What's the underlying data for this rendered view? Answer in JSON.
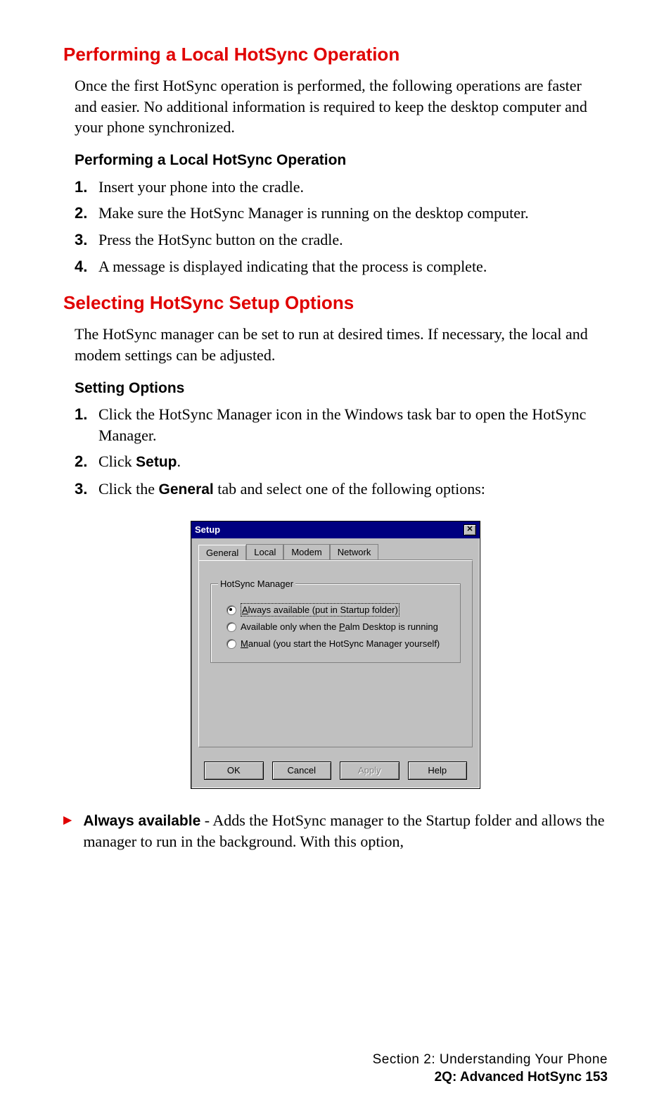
{
  "section1": {
    "heading": "Performing a Local HotSync Operation",
    "para": "Once the first HotSync operation is performed, the following operations are faster and easier. No additional information is required to keep the desktop computer and your phone synchronized.",
    "subheading": "Performing a Local HotSync Operation",
    "steps": [
      "Insert your phone into the cradle.",
      "Make sure the HotSync Manager is running on the desktop computer.",
      "Press the HotSync button on the cradle.",
      "A message is displayed indicating that the process is complete."
    ]
  },
  "section2": {
    "heading": "Selecting HotSync Setup Options",
    "para": "The HotSync manager can be set to run at desired times. If necessary, the local and modem settings can be adjusted.",
    "subheading": "Setting Options",
    "steps": [
      {
        "pre": "Click the HotSync Manager icon in the Windows task bar to open the HotSync Manager."
      },
      {
        "pre": "Click ",
        "bold": "Setup",
        "post": "."
      },
      {
        "pre": "Click the ",
        "bold": "General",
        "post": " tab and select one of the following options:"
      }
    ]
  },
  "dialog": {
    "title": "Setup",
    "tabs": [
      "General",
      "Local",
      "Modem",
      "Network"
    ],
    "groupLabel": "HotSync Manager",
    "options": [
      {
        "label": "Always available (put in Startup folder)",
        "underlineChar": "A",
        "selected": true
      },
      {
        "label": "Available only when the Palm Desktop is running",
        "underlineChar": "P",
        "selected": false
      },
      {
        "label": "Manual (you start the HotSync Manager yourself)",
        "underlineChar": "M",
        "selected": false
      }
    ],
    "buttons": {
      "ok": "OK",
      "cancel": "Cancel",
      "apply": "Apply",
      "help": "Help"
    }
  },
  "bullet": {
    "lead": "Always available",
    "rest": " - Adds the HotSync manager to the Startup folder and allows the manager to run in the background. With this option,"
  },
  "footer": {
    "line1": "Section 2: Understanding Your Phone",
    "line2": "2Q: Advanced HotSync   153"
  }
}
